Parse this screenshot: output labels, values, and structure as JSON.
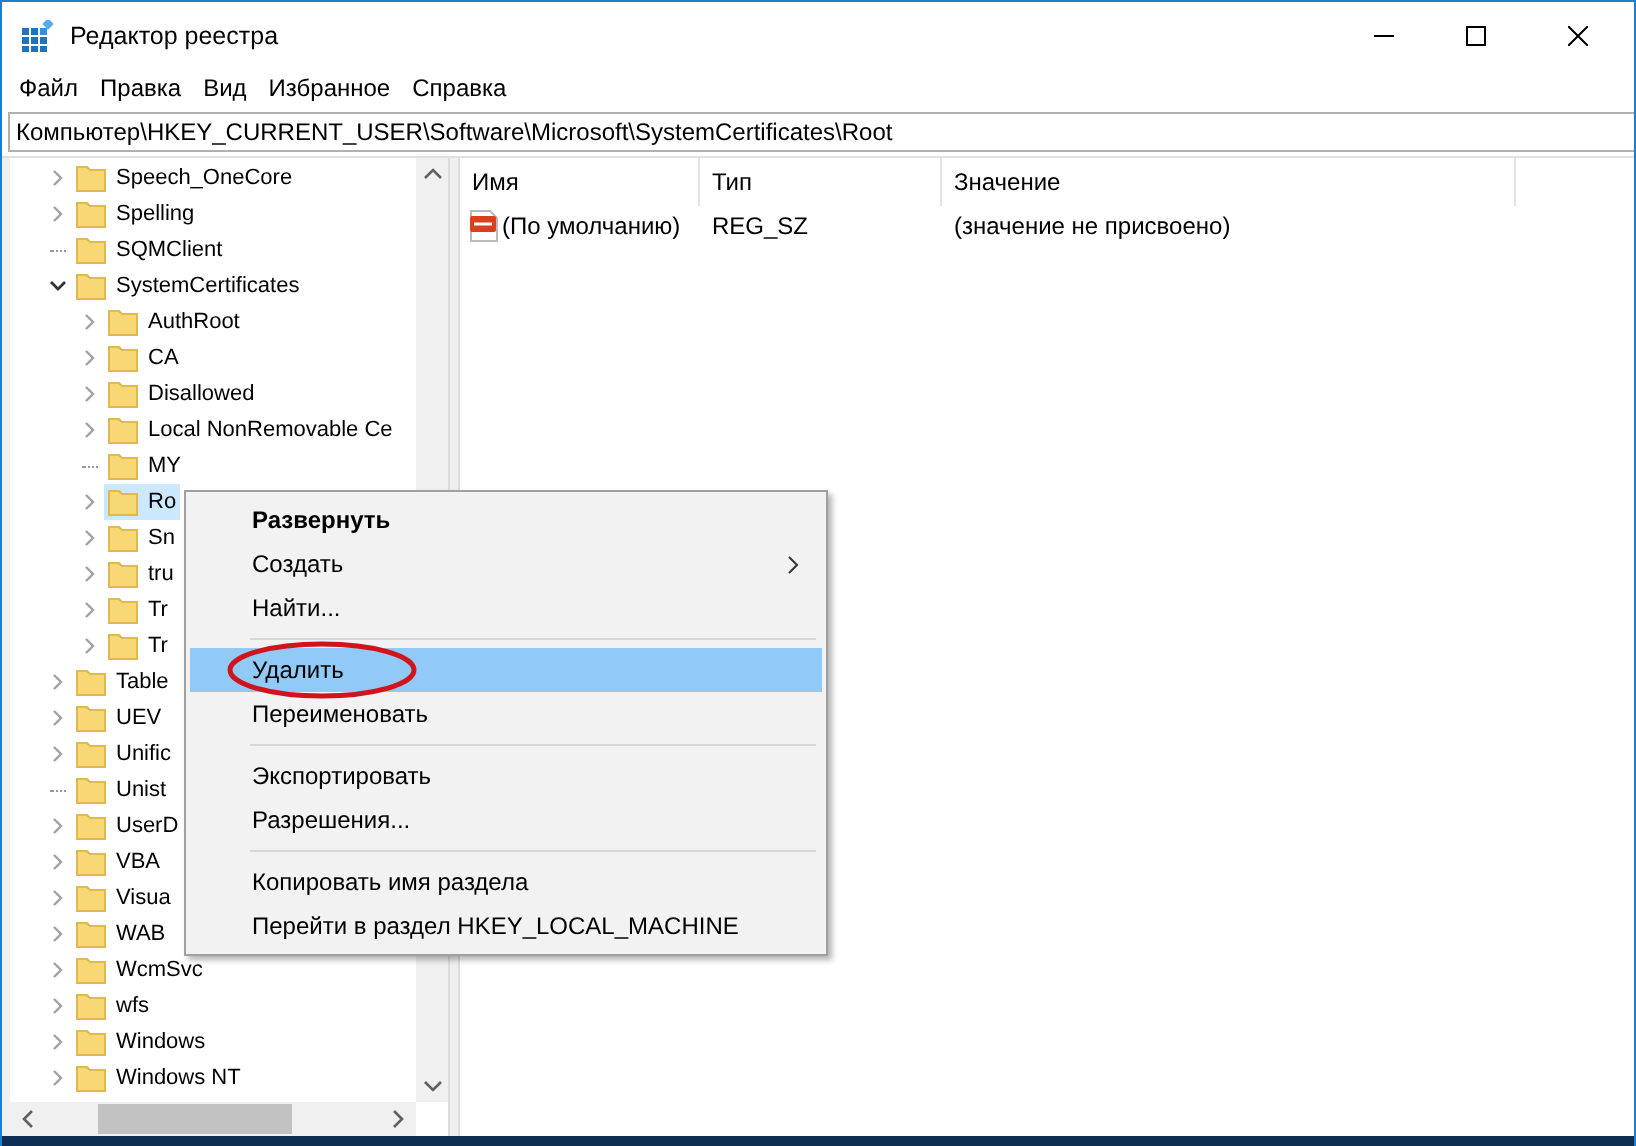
{
  "window": {
    "title": "Редактор реестра"
  },
  "menu_bar": [
    "Файл",
    "Правка",
    "Вид",
    "Избранное",
    "Справка"
  ],
  "address_bar": "Компьютер\\HKEY_CURRENT_USER\\Software\\Microsoft\\SystemCertificates\\Root",
  "tree": [
    {
      "label": "Speech_OneCore",
      "expandable": true,
      "expanded": false,
      "selected": false
    },
    {
      "label": "Spelling",
      "expandable": true,
      "expanded": false,
      "selected": false
    },
    {
      "label": "SQMClient",
      "expandable": false,
      "selected": false
    },
    {
      "label": "SystemCertificates",
      "expandable": true,
      "expanded": true,
      "selected": false,
      "children": [
        {
          "label": "AuthRoot",
          "expandable": true,
          "expanded": false,
          "selected": false
        },
        {
          "label": "CA",
          "expandable": true,
          "expanded": false,
          "selected": false
        },
        {
          "label": "Disallowed",
          "expandable": true,
          "expanded": false,
          "selected": false
        },
        {
          "label": "Local NonRemovable Ce",
          "expandable": true,
          "expanded": false,
          "selected": false
        },
        {
          "label": "MY",
          "expandable": false,
          "selected": false
        },
        {
          "label": "Ro",
          "expandable": true,
          "expanded": false,
          "selected": true
        },
        {
          "label": "Sn",
          "expandable": true,
          "expanded": false,
          "selected": false
        },
        {
          "label": "tru",
          "expandable": true,
          "expanded": false,
          "selected": false
        },
        {
          "label": "Tr",
          "expandable": true,
          "expanded": false,
          "selected": false
        },
        {
          "label": "Tr",
          "expandable": true,
          "expanded": false,
          "selected": false
        }
      ]
    },
    {
      "label": "Table",
      "expandable": true,
      "expanded": false,
      "selected": false
    },
    {
      "label": "UEV",
      "expandable": true,
      "expanded": false,
      "selected": false
    },
    {
      "label": "Unific",
      "expandable": true,
      "expanded": false,
      "selected": false
    },
    {
      "label": "Unist",
      "expandable": false,
      "selected": false
    },
    {
      "label": "UserD",
      "expandable": true,
      "expanded": false,
      "selected": false
    },
    {
      "label": "VBA",
      "expandable": true,
      "expanded": false,
      "selected": false
    },
    {
      "label": "Visua",
      "expandable": true,
      "expanded": false,
      "selected": false
    },
    {
      "label": "WAB",
      "expandable": true,
      "expanded": false,
      "selected": false
    },
    {
      "label": "WcmSvc",
      "expandable": true,
      "expanded": false,
      "selected": false
    },
    {
      "label": "wfs",
      "expandable": true,
      "expanded": false,
      "selected": false
    },
    {
      "label": "Windows",
      "expandable": true,
      "expanded": false,
      "selected": false
    },
    {
      "label": "Windows NT",
      "expandable": true,
      "expanded": false,
      "selected": false
    }
  ],
  "table": {
    "columns": [
      "Имя",
      "Тип",
      "Значение"
    ],
    "rows": [
      [
        "(По умолчанию)",
        "REG_SZ",
        "(значение не присвоено)"
      ]
    ]
  },
  "context_menu": [
    {
      "kind": "item",
      "label": "Развернуть",
      "bold": true,
      "submenu": false,
      "selected": false
    },
    {
      "kind": "item",
      "label": "Создать",
      "bold": false,
      "submenu": true,
      "selected": false
    },
    {
      "kind": "item",
      "label": "Найти...",
      "bold": false,
      "submenu": false,
      "selected": false
    },
    {
      "kind": "separator"
    },
    {
      "kind": "item",
      "label": "Удалить",
      "bold": false,
      "submenu": false,
      "selected": true
    },
    {
      "kind": "item",
      "label": "Переименовать",
      "bold": false,
      "submenu": false,
      "selected": false
    },
    {
      "kind": "separator"
    },
    {
      "kind": "item",
      "label": "Экспортировать",
      "bold": false,
      "submenu": false,
      "selected": false
    },
    {
      "kind": "item",
      "label": "Разрешения...",
      "bold": false,
      "submenu": false,
      "selected": false
    },
    {
      "kind": "separator"
    },
    {
      "kind": "item",
      "label": "Копировать имя раздела",
      "bold": false,
      "submenu": false,
      "selected": false
    },
    {
      "kind": "item",
      "label": "Перейти в раздел HKEY_LOCAL_MACHINE",
      "bold": false,
      "submenu": false,
      "selected": false
    }
  ]
}
